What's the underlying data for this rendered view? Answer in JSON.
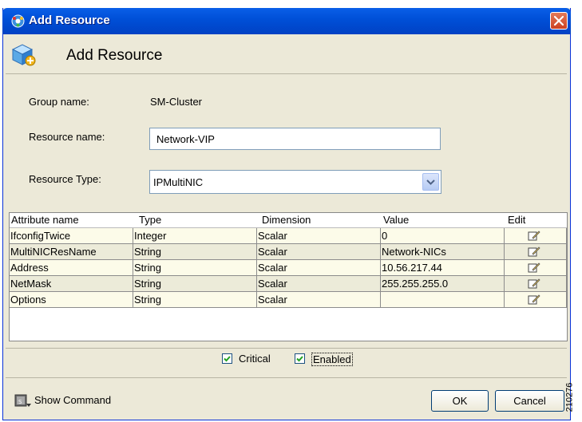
{
  "window": {
    "title": "Add Resource"
  },
  "header": {
    "title": "Add Resource"
  },
  "form": {
    "group_name_label": "Group name:",
    "group_name_value": "SM-Cluster",
    "resource_name_label": "Resource name:",
    "resource_name_value": "Network-VIP",
    "resource_type_label": "Resource Type:",
    "resource_type_value": "IPMultiNIC"
  },
  "table": {
    "headers": [
      "Attribute name",
      "Type",
      "Dimension",
      "Value",
      "Edit"
    ],
    "rows": [
      {
        "name": "IfconfigTwice",
        "type": "Integer",
        "dimension": "Scalar",
        "value": "0"
      },
      {
        "name": "MultiNICResName",
        "type": "String",
        "dimension": "Scalar",
        "value": "Network-NICs"
      },
      {
        "name": "Address",
        "type": "String",
        "dimension": "Scalar",
        "value": "10.56.217.44"
      },
      {
        "name": "NetMask",
        "type": "String",
        "dimension": "Scalar",
        "value": "255.255.255.0"
      },
      {
        "name": "Options",
        "type": "String",
        "dimension": "Scalar",
        "value": ""
      }
    ],
    "row_colors": [
      "#fcfbe9",
      "#ecebd9"
    ]
  },
  "checkboxes": {
    "critical": {
      "label": "Critical",
      "checked": true
    },
    "enabled": {
      "label": "Enabled",
      "checked": true
    }
  },
  "footer": {
    "show_command_label": "Show Command",
    "ok_label": "OK",
    "cancel_label": "Cancel"
  },
  "watermark": "210276",
  "icons": {
    "app": "cluster-app-icon",
    "close": "close-icon",
    "header": "add-resource-icon",
    "edit": "edit-pencil-icon",
    "show_command": "terminal-icon",
    "dropdown": "chevron-down-icon"
  }
}
